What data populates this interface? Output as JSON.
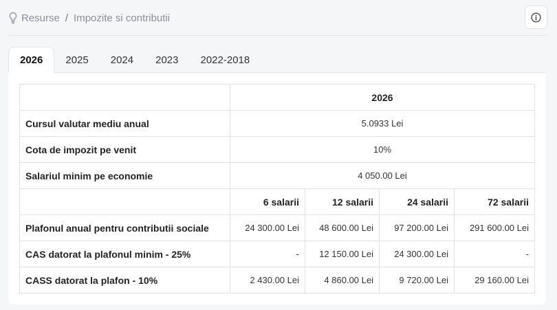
{
  "breadcrumb": {
    "root": "Resurse",
    "separator": "/",
    "current": "Impozite si contributii"
  },
  "info_button": {
    "icon": "info-icon"
  },
  "tabs": [
    "2026",
    "2025",
    "2024",
    "2023",
    "2022-2018"
  ],
  "active_tab": "2026",
  "table": {
    "year_header": "2026",
    "rows_single": [
      {
        "label": "Cursul valutar mediu anual",
        "value": "5.0933 Lei"
      },
      {
        "label": "Cota de impozit pe venit",
        "value": "10%"
      },
      {
        "label": "Salariul minim pe economie",
        "value": "4 050.00 Lei"
      }
    ],
    "columns": [
      "6 salarii",
      "12 salarii",
      "24 salarii",
      "72 salarii"
    ],
    "rows_multi": [
      {
        "label": "Plafonul anual pentru contributii sociale",
        "values": [
          "24 300.00 Lei",
          "48 600.00 Lei",
          "97 200.00 Lei",
          "291 600.00 Lei"
        ]
      },
      {
        "label": "CAS datorat la plafonul minim - 25%",
        "values": [
          "-",
          "12 150.00 Lei",
          "24 300.00 Lei",
          "-"
        ]
      },
      {
        "label": "CASS datorat la plafon - 10%",
        "values": [
          "2 430.00 Lei",
          "4 860.00 Lei",
          "9 720.00 Lei",
          "29 160.00 Lei"
        ]
      }
    ]
  }
}
